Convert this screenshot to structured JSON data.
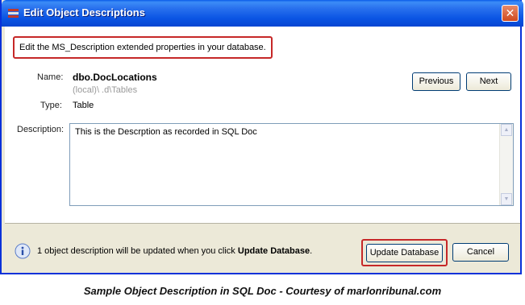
{
  "window": {
    "title": "Edit Object Descriptions",
    "close_label": "✕"
  },
  "info": {
    "text": "Edit the MS_Description extended properties in your database."
  },
  "fields": {
    "name_label": "Name:",
    "name_value": "dbo.DocLocations",
    "path_value": "(local)\\ .d\\Tables",
    "type_label": "Type:",
    "type_value": "Table",
    "description_label": "Description:",
    "description_value": "This is the Descrption as recorded in SQL Doc"
  },
  "nav": {
    "previous_label": "Previous",
    "next_label": "Next"
  },
  "footer": {
    "message_prefix": "1 object description will be updated when you click",
    "message_bold": "Update Database",
    "message_suffix": ".",
    "update_label": "Update Database",
    "cancel_label": "Cancel"
  },
  "caption": "Sample Object Description in SQL Doc - Courtesy of marlonribunal.com",
  "colors": {
    "titlebar": "#0a54e3",
    "highlight": "#c62828",
    "dialog_bg": "#ece9d8"
  }
}
